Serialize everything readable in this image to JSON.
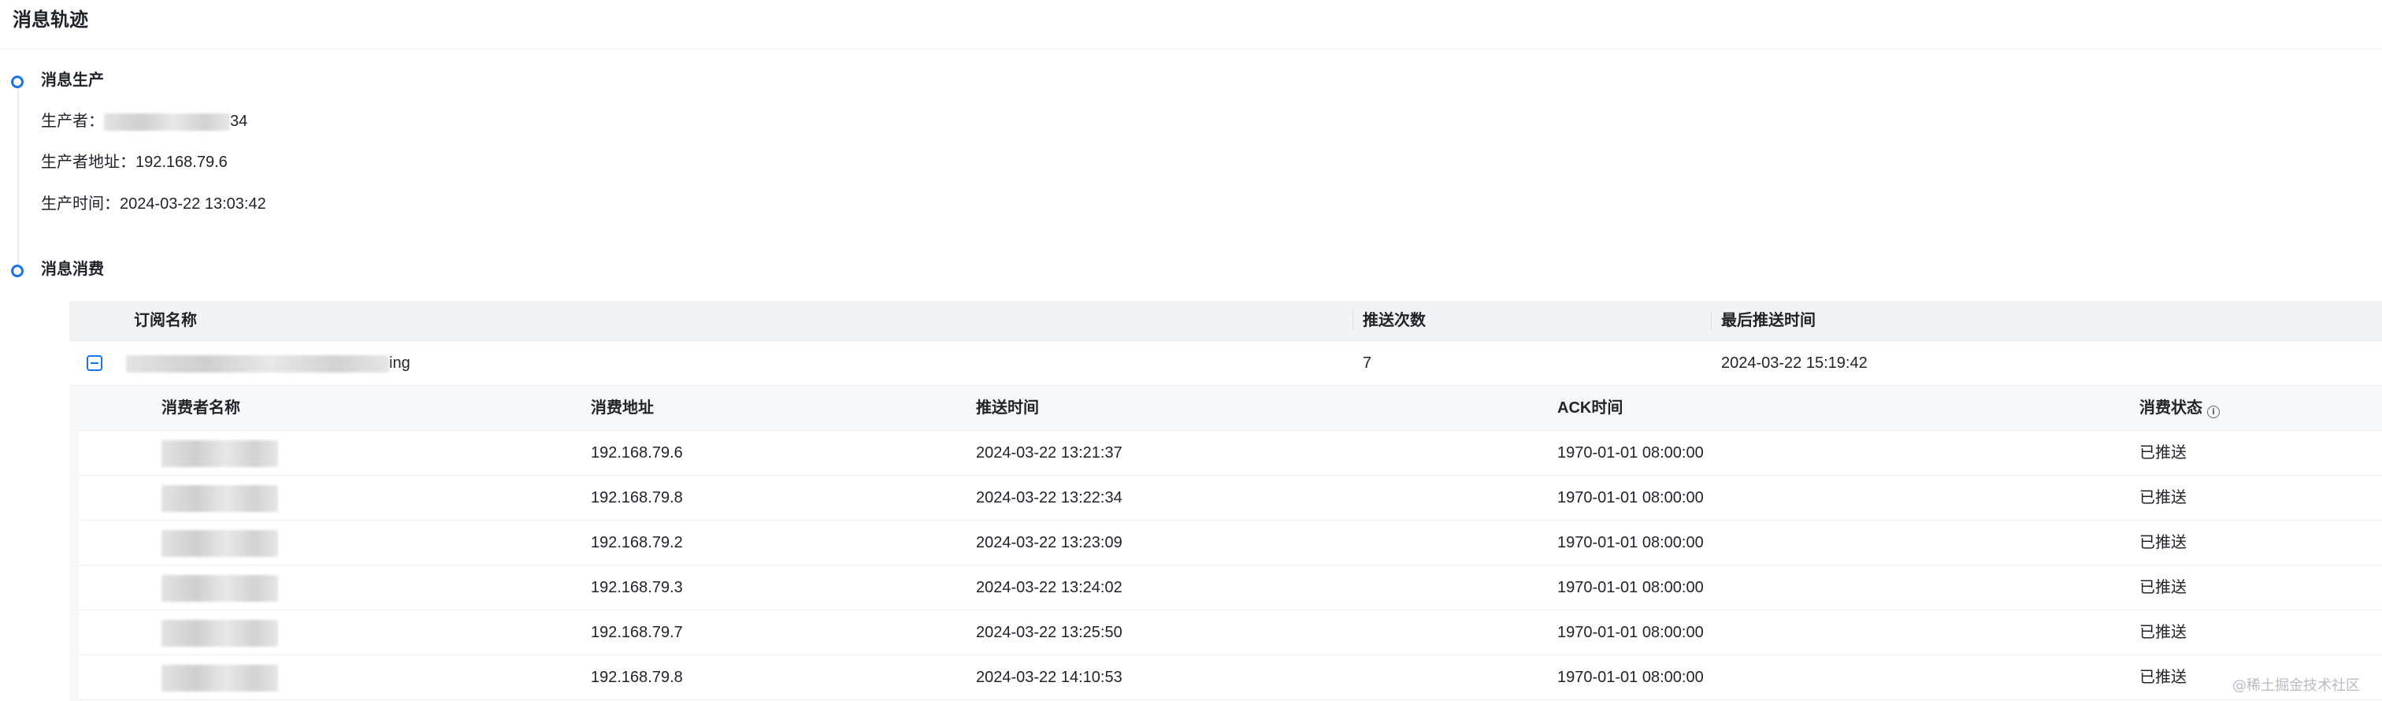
{
  "page": {
    "title": "消息轨迹"
  },
  "production": {
    "section_title": "消息生产",
    "producer_label": "生产者：",
    "producer_value_suffix": "34",
    "producer_address_label": "生产者地址：",
    "producer_address": "192.168.79.6",
    "produce_time_label": "生产时间：",
    "produce_time": "2024-03-22 13:03:42"
  },
  "consumption": {
    "section_title": "消息消费",
    "subscription_table": {
      "columns": [
        "订阅名称",
        "推送次数",
        "最后推送时间"
      ],
      "rows": [
        {
          "name_suffix": "ing",
          "push_count": "7",
          "last_push_time": "2024-03-22 15:19:42",
          "expanded": true
        }
      ]
    },
    "consumer_table": {
      "columns": [
        "消费者名称",
        "消费地址",
        "推送时间",
        "ACK时间",
        "消费状态"
      ],
      "rows": [
        {
          "address": "192.168.79.6",
          "push_time": "2024-03-22 13:21:37",
          "ack_time": "1970-01-01 08:00:00",
          "status": "已推送"
        },
        {
          "address": "192.168.79.8",
          "push_time": "2024-03-22 13:22:34",
          "ack_time": "1970-01-01 08:00:00",
          "status": "已推送"
        },
        {
          "address": "192.168.79.2",
          "push_time": "2024-03-22 13:23:09",
          "ack_time": "1970-01-01 08:00:00",
          "status": "已推送"
        },
        {
          "address": "192.168.79.3",
          "push_time": "2024-03-22 13:24:02",
          "ack_time": "1970-01-01 08:00:00",
          "status": "已推送"
        },
        {
          "address": "192.168.79.7",
          "push_time": "2024-03-22 13:25:50",
          "ack_time": "1970-01-01 08:00:00",
          "status": "已推送"
        },
        {
          "address": "192.168.79.8",
          "push_time": "2024-03-22 14:10:53",
          "ack_time": "1970-01-01 08:00:00",
          "status": "已推送"
        }
      ]
    }
  },
  "watermark": "@稀土掘金技术社区",
  "colors": {
    "accent": "#1a73e8",
    "text": "#1f2329",
    "header_bg": "#f2f3f5"
  }
}
